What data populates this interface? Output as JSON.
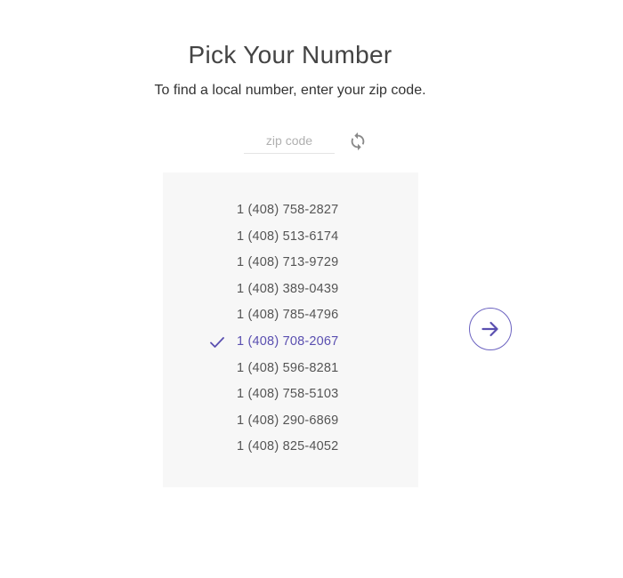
{
  "header": {
    "title": "Pick Your Number",
    "subtitle": "To find a local number, enter your zip code."
  },
  "zip": {
    "value": "",
    "placeholder": "zip code"
  },
  "icons": {
    "refresh": "refresh-icon",
    "check": "check-icon",
    "next": "arrow-right-icon"
  },
  "numbers": [
    {
      "label": "1 (408) 758-2827",
      "selected": false
    },
    {
      "label": "1 (408) 513-6174",
      "selected": false
    },
    {
      "label": "1 (408) 713-9729",
      "selected": false
    },
    {
      "label": "1 (408) 389-0439",
      "selected": false
    },
    {
      "label": "1 (408) 785-4796",
      "selected": false
    },
    {
      "label": "1 (408) 708-2067",
      "selected": true
    },
    {
      "label": "1 (408) 596-8281",
      "selected": false
    },
    {
      "label": "1 (408) 758-5103",
      "selected": false
    },
    {
      "label": "1 (408) 290-6869",
      "selected": false
    },
    {
      "label": "1 (408) 825-4052",
      "selected": false
    }
  ],
  "colors": {
    "accent": "#5a4fb0",
    "panel_bg": "#f7f7f7",
    "icon_gray": "#888888"
  }
}
